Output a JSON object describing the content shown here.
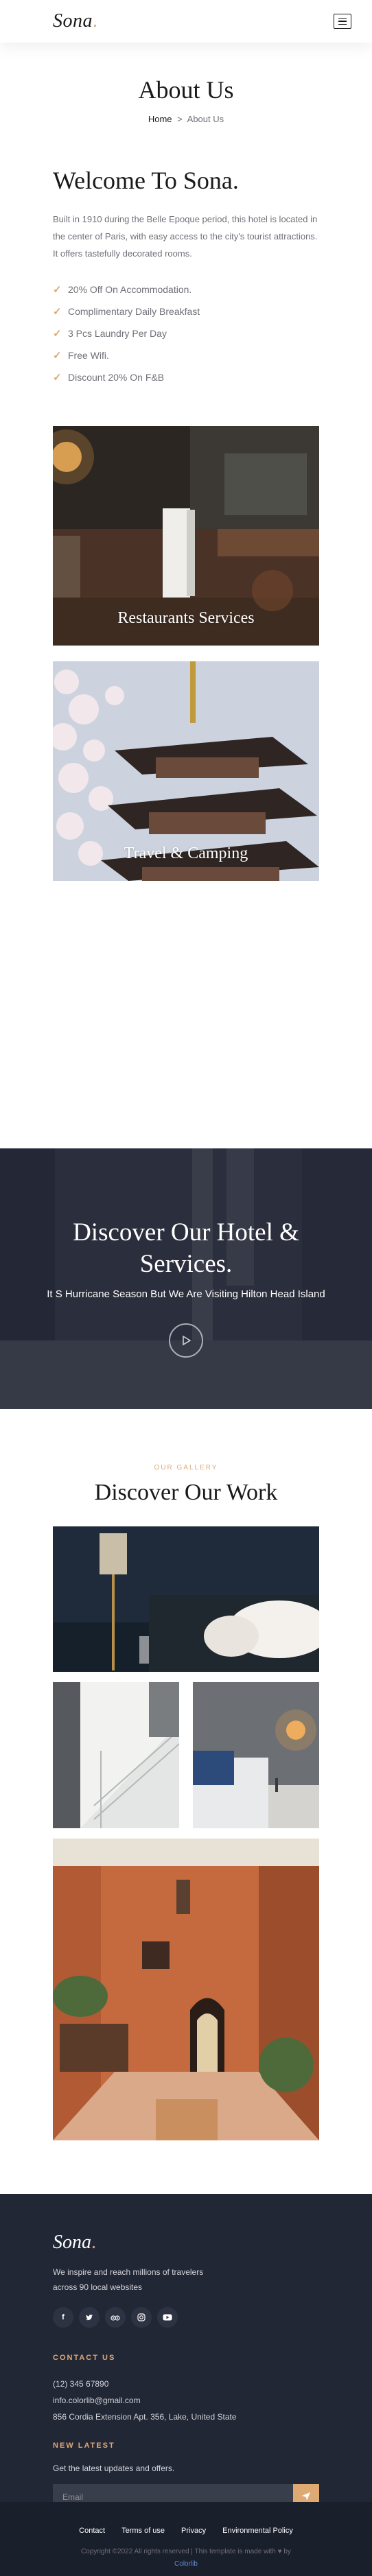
{
  "header": {
    "logo_text": "Sona",
    "logo_dot": ".",
    "menu_icon": "hamburger-menu-icon"
  },
  "breadcrumb": {
    "title": "About Us",
    "home": "Home",
    "separator": ">",
    "current": "About Us"
  },
  "about": {
    "heading": "Welcome To Sona.",
    "paragraph": "Built in 1910 during the Belle Epoque period, this hotel is located in the center of Paris, with easy access to the city's tourist attractions. It offers tastefully decorated rooms.",
    "features": [
      "20% Off On Accommodation.",
      "Complimentary Daily Breakfast",
      "3 Pcs Laundry Per Day",
      "Free Wifi.",
      "Discount 20% On F&B"
    ]
  },
  "services": [
    {
      "label": "Restaurants Services"
    },
    {
      "label": "Travel & Camping"
    }
  ],
  "video": {
    "title": "Discover Our Hotel & Services.",
    "subtitle": "It S Hurricane Season But We Are Visiting Hilton Head Island",
    "play_icon": "play-icon"
  },
  "gallery": {
    "subtitle": "Our Gallery",
    "title": "Discover Our Work"
  },
  "footer": {
    "logo_text": "Sona",
    "logo_dot": ".",
    "description": "We inspire and reach millions of travelers across 90 local websites",
    "socials": [
      "facebook-icon",
      "twitter-icon",
      "tripadvisor-icon",
      "instagram-icon",
      "youtube-icon"
    ],
    "contact_heading": "Contact Us",
    "phone": "(12) 345 67890",
    "email": "info.colorlib@gmail.com",
    "address": "856 Cordia Extension Apt. 356, Lake, United State",
    "newsletter_heading": "New Latest",
    "newsletter_text": "Get the latest updates and offers.",
    "email_placeholder": "Email",
    "links": [
      "Contact",
      "Terms of use",
      "Privacy",
      "Environmental Policy"
    ],
    "copyright": "Copyright ©2022 All rights reserved | This template is made with",
    "copyright_by": "by",
    "copyright_link": "Colorlib"
  },
  "colors": {
    "accent": "#dfa974",
    "dark": "#222736",
    "text": "#19191a",
    "muted": "#707079"
  }
}
